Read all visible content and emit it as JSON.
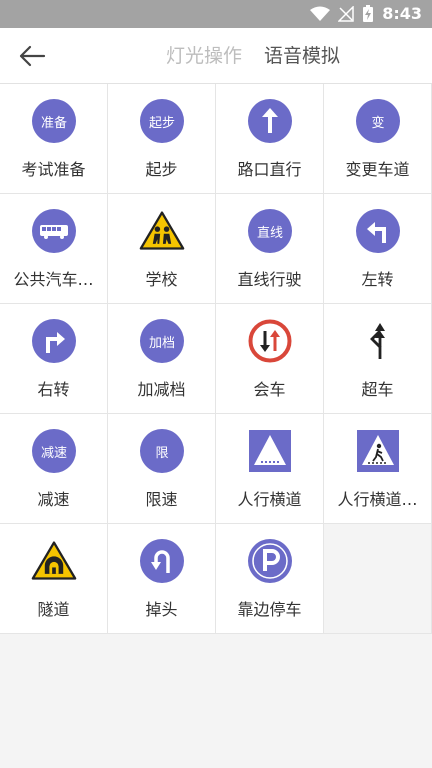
{
  "status": {
    "time": "8:43"
  },
  "header": {
    "tabs": [
      {
        "label": "灯光操作",
        "active": false
      },
      {
        "label": "语音模拟",
        "active": true
      }
    ]
  },
  "colors": {
    "accent": "#6b6bc8",
    "warning_yellow": "#f5c400",
    "red": "#d9473a"
  },
  "items": [
    {
      "label": "考试准备",
      "icon_text": "准备",
      "icon": "circle-text-icon"
    },
    {
      "label": "起步",
      "icon_text": "起步",
      "icon": "circle-text-icon"
    },
    {
      "label": "路口直行",
      "icon": "straight-arrow-icon"
    },
    {
      "label": "变更车道",
      "icon_text": "变",
      "icon": "circle-text-icon"
    },
    {
      "label": "公共汽车…",
      "icon": "bus-icon"
    },
    {
      "label": "学校",
      "icon": "school-warning-icon"
    },
    {
      "label": "直线行驶",
      "icon_text": "直线",
      "icon": "circle-text-icon"
    },
    {
      "label": "左转",
      "icon": "turn-left-icon"
    },
    {
      "label": "右转",
      "icon": "turn-right-icon"
    },
    {
      "label": "加减档",
      "icon_text": "加档",
      "icon": "circle-text-icon"
    },
    {
      "label": "会车",
      "icon": "meeting-car-icon"
    },
    {
      "label": "超车",
      "icon": "overtake-icon"
    },
    {
      "label": "减速",
      "icon_text": "减速",
      "icon": "circle-text-icon"
    },
    {
      "label": "限速",
      "icon_text": "限",
      "icon": "circle-text-icon"
    },
    {
      "label": "人行横道",
      "icon": "crosswalk-icon"
    },
    {
      "label": "人行横道…",
      "icon": "crosswalk-person-icon"
    },
    {
      "label": "隧道",
      "icon": "tunnel-warning-icon"
    },
    {
      "label": "掉头",
      "icon": "u-turn-icon"
    },
    {
      "label": "靠边停车",
      "icon": "parking-icon"
    }
  ]
}
